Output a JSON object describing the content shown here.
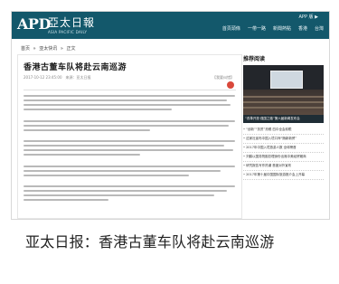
{
  "header": {
    "logo_latin": "APD",
    "logo_cn": "亞太日報",
    "logo_en": "ASIA PACIFIC DAILY",
    "app_link": "APP 版 ▶"
  },
  "nav": [
    "首頁頭條",
    "一帶一路",
    "新聞熱點",
    "香港",
    "台灣"
  ],
  "breadcrumb": [
    "首页",
    "亚太快讯",
    "正文"
  ],
  "article": {
    "title": "香港古董车队将赴云南巡游",
    "meta": "2017-10-12 23:45:00　来源：亚太日报",
    "correction": "【我要纠错】"
  },
  "sidebar": {
    "heading": "推荐阅读",
    "photo_caption": "“改革开放·强国之路”第六届新闻发布会",
    "items": [
      "“创新”“扶贫”亮眼 四中全会前瞻",
      "这家社宣布中国入境口岸“随新新贸”",
      "2017年中国入境旅游人数 全球榜首",
      "刘鹤以国务院副总理身份出席中美经贸磋商",
      "研究报告写作热潮 首度对外宣布",
      "2017年第十届中国国际旅游推介会上开幕"
    ]
  },
  "caption": "亚太日报：香港古董车队将赴云南巡游",
  "colors": {
    "header_bg": "#13586b",
    "share_icons": [
      "#e04b3a",
      "#f0a020",
      "#3d8fd8",
      "#5bb24c"
    ]
  }
}
